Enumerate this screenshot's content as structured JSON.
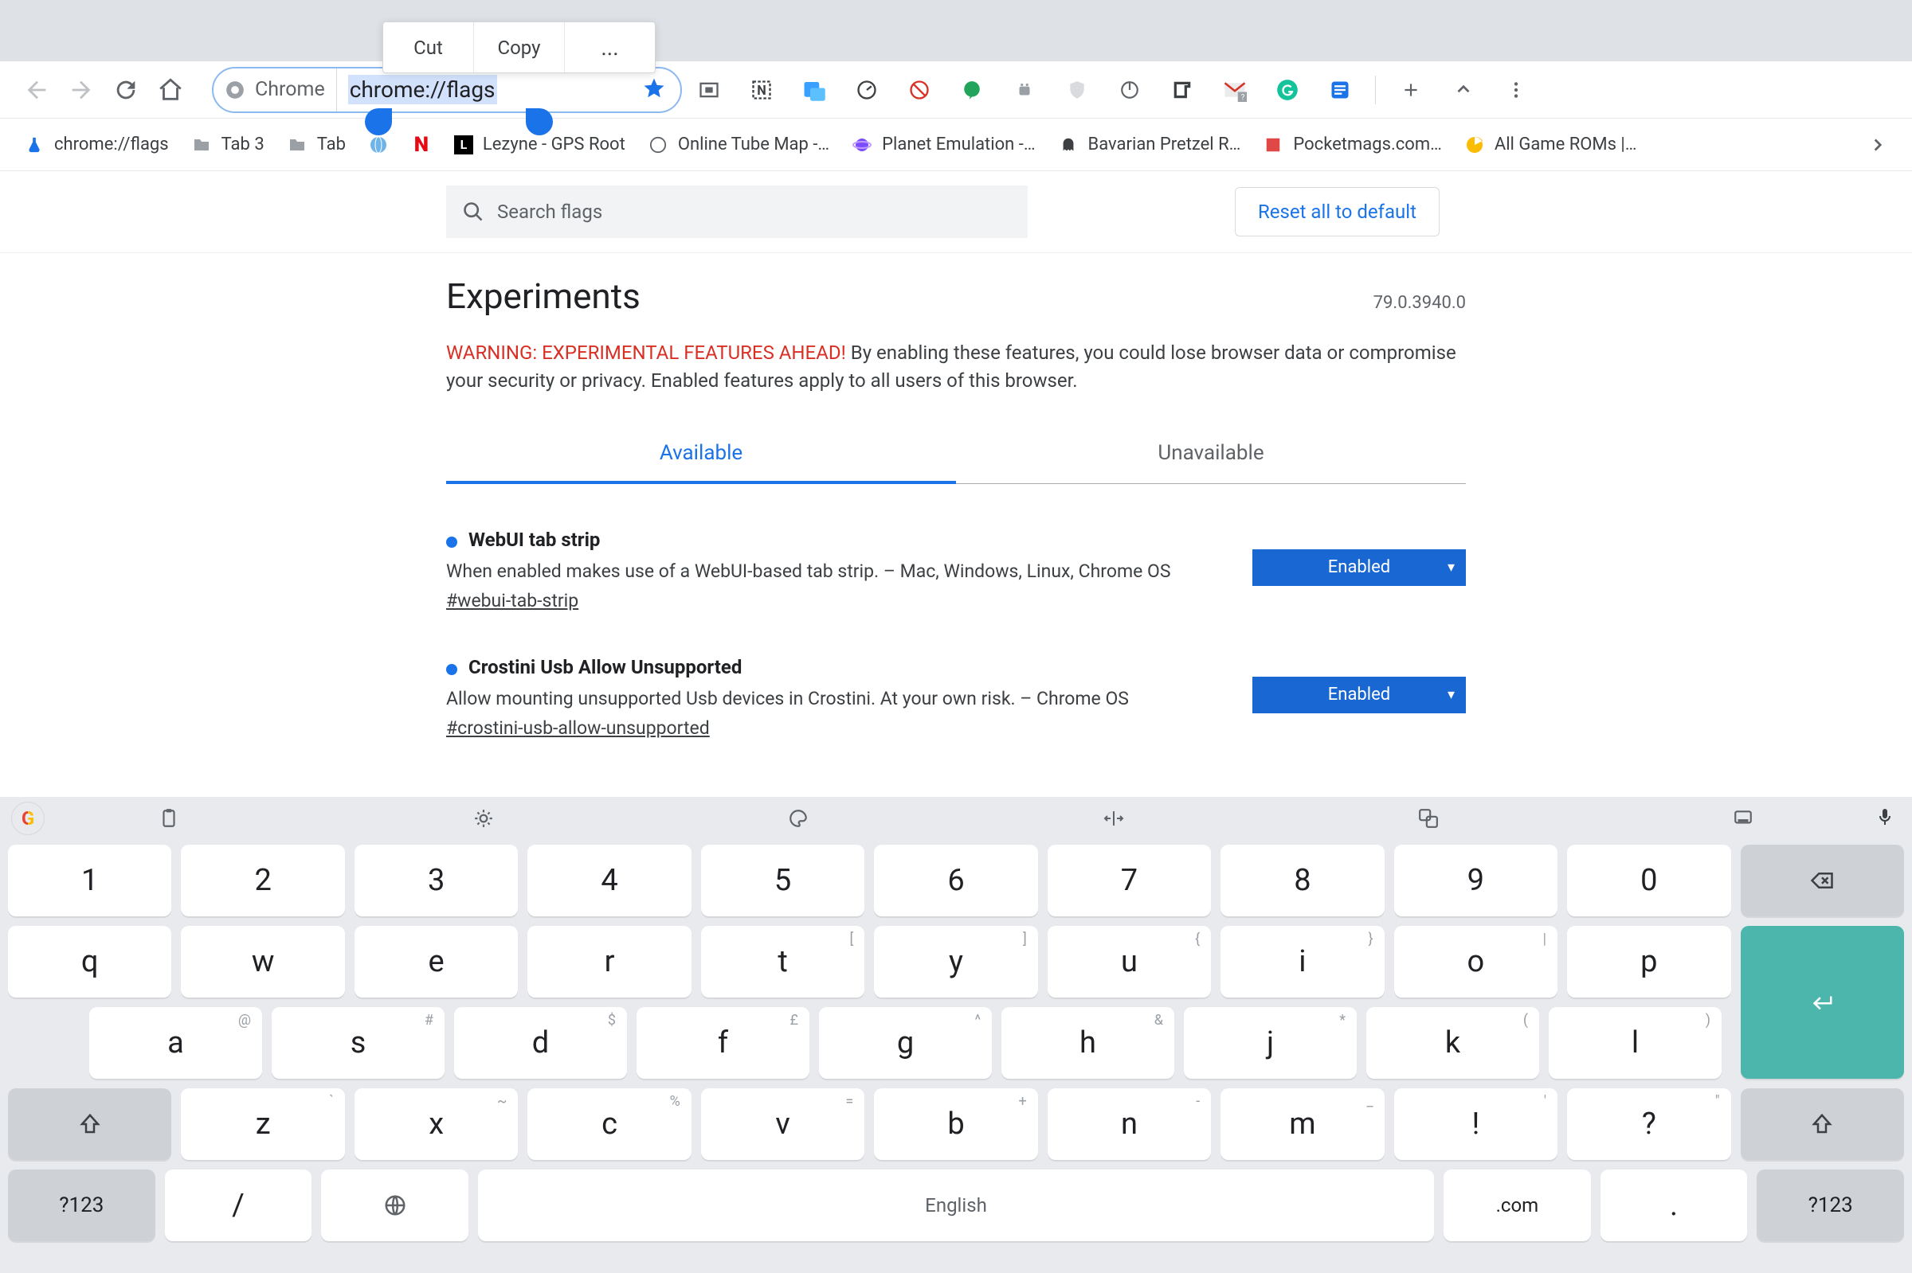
{
  "context_menu": {
    "cut": "Cut",
    "copy": "Copy",
    "more": "..."
  },
  "toolbar": {
    "omnibox_chip": "Chrome",
    "omnibox_url": "chrome://flags"
  },
  "bookmarks": [
    {
      "icon": "flask",
      "label": "chrome://flags"
    },
    {
      "icon": "folder",
      "label": "Tab 3"
    },
    {
      "icon": "folder",
      "label": "Tab"
    },
    {
      "icon": "globe",
      "label": ""
    },
    {
      "icon": "netflix",
      "label": ""
    },
    {
      "icon": "lezyne",
      "label": "Lezyne - GPS Root"
    },
    {
      "icon": "globe",
      "label": "Online Tube Map -…"
    },
    {
      "icon": "planet",
      "label": "Planet Emulation -…"
    },
    {
      "icon": "ghost",
      "label": "Bavarian Pretzel R…"
    },
    {
      "icon": "pm",
      "label": "Pocketmags.com…"
    },
    {
      "icon": "pac",
      "label": "All Game ROMs |…"
    }
  ],
  "flags": {
    "search_placeholder": "Search flags",
    "reset": "Reset all to default",
    "title": "Experiments",
    "version": "79.0.3940.0",
    "warning_bold": "WARNING: EXPERIMENTAL FEATURES AHEAD!",
    "warning_rest": " By enabling these features, you could lose browser data or compromise your security or privacy. Enabled features apply to all users of this browser.",
    "tab_available": "Available",
    "tab_unavailable": "Unavailable",
    "items": [
      {
        "name": "WebUI tab strip",
        "desc": "When enabled makes use of a WebUI-based tab strip. – Mac, Windows, Linux, Chrome OS",
        "hash": "#webui-tab-strip",
        "state": "Enabled"
      },
      {
        "name": "Crostini Usb Allow Unsupported",
        "desc": "Allow mounting unsupported Usb devices in Crostini. At your own risk. – Chrome OS",
        "hash": "#crostini-usb-allow-unsupported",
        "state": "Enabled"
      }
    ]
  },
  "keyboard": {
    "row_num": [
      "1",
      "2",
      "3",
      "4",
      "5",
      "6",
      "7",
      "8",
      "9",
      "0"
    ],
    "row_q": [
      "q",
      "w",
      "e",
      "r",
      "t",
      "y",
      "u",
      "i",
      "o",
      "p"
    ],
    "row_q_sup": [
      "",
      "",
      "",
      "",
      "[",
      "]",
      "{",
      "}",
      "|",
      ""
    ],
    "row_a": [
      "a",
      "s",
      "d",
      "f",
      "g",
      "h",
      "j",
      "k",
      "l"
    ],
    "row_a_sup": [
      "@",
      "#",
      "$",
      "£",
      "^",
      "&",
      "*",
      "(",
      ")"
    ],
    "row_z": [
      "z",
      "x",
      "c",
      "v",
      "b",
      "n",
      "m",
      "!",
      "?"
    ],
    "row_z_sup": [
      "`",
      "~",
      "%",
      "=",
      "+",
      "-",
      "_",
      "'",
      "\""
    ],
    "sym": "?123",
    "slash": "/",
    "space": "English",
    "dotcom": ".com",
    "dot": "."
  }
}
